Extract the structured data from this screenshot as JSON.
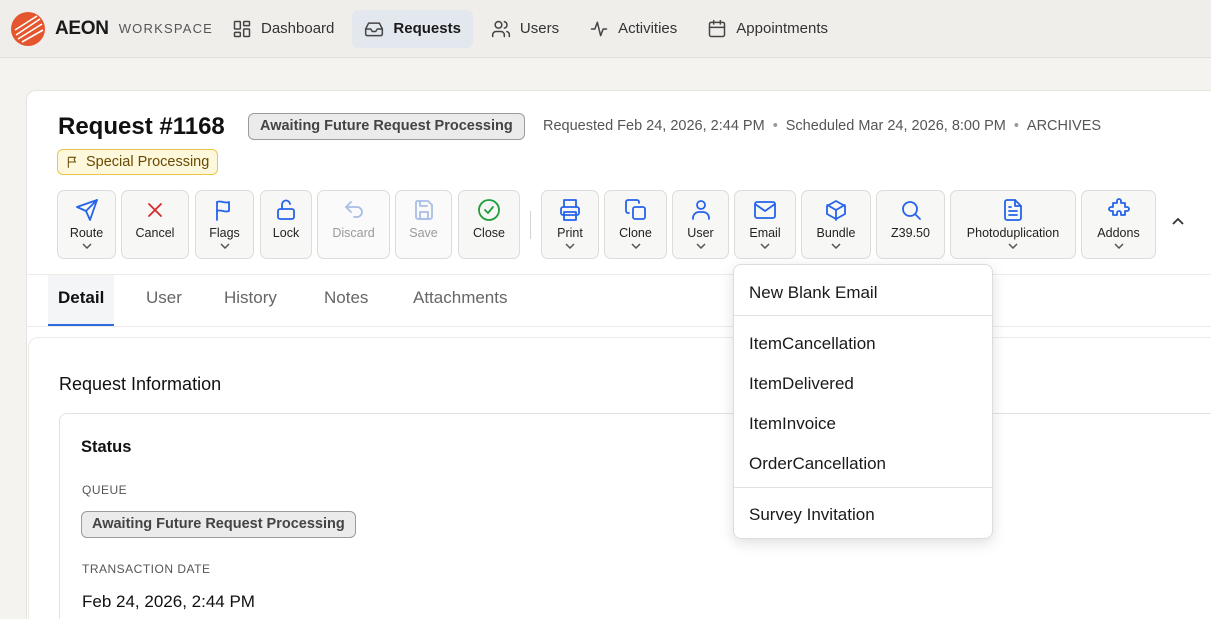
{
  "brand": {
    "name": "AEON",
    "sub": "WORKSPACE",
    "accent": "#e4572e"
  },
  "nav": {
    "items": [
      {
        "label": "Dashboard",
        "icon": "grid-icon"
      },
      {
        "label": "Requests",
        "icon": "inbox-icon",
        "active": true
      },
      {
        "label": "Users",
        "icon": "users-icon"
      },
      {
        "label": "Activities",
        "icon": "activity-icon"
      },
      {
        "label": "Appointments",
        "icon": "calendar-icon"
      }
    ]
  },
  "request": {
    "title": "Request #1168",
    "status": "Awaiting Future Request Processing",
    "requested": "Requested Feb 24, 2026, 2:44 PM",
    "scheduled": "Scheduled Mar 24, 2026, 8:00 PM",
    "location": "ARCHIVES",
    "special": "Special Processing"
  },
  "toolbar": {
    "route": "Route",
    "cancel": "Cancel",
    "flags": "Flags",
    "lock": "Lock",
    "discard": "Discard",
    "save": "Save",
    "close": "Close",
    "print": "Print",
    "clone": "Clone",
    "user": "User",
    "email": "Email",
    "bundle": "Bundle",
    "z3950": "Z39.50",
    "photodup": "Photoduplication",
    "addons": "Addons"
  },
  "tabs": [
    "Detail",
    "User",
    "History",
    "Notes",
    "Attachments"
  ],
  "section": {
    "title": "Request Information",
    "status_title": "Status",
    "queue_label": "QUEUE",
    "queue_value": "Awaiting Future Request Processing",
    "date_label": "TRANSACTION DATE",
    "date_value": "Feb 24, 2026, 2:44 PM"
  },
  "email_menu": {
    "items": [
      "New Blank Email",
      "ItemCancellation",
      "ItemDelivered",
      "ItemInvoice",
      "OrderCancellation",
      "Survey Invitation"
    ]
  },
  "colors": {
    "primary": "#2563eb",
    "danger": "#d52a2a",
    "success": "#1f9d3a"
  }
}
